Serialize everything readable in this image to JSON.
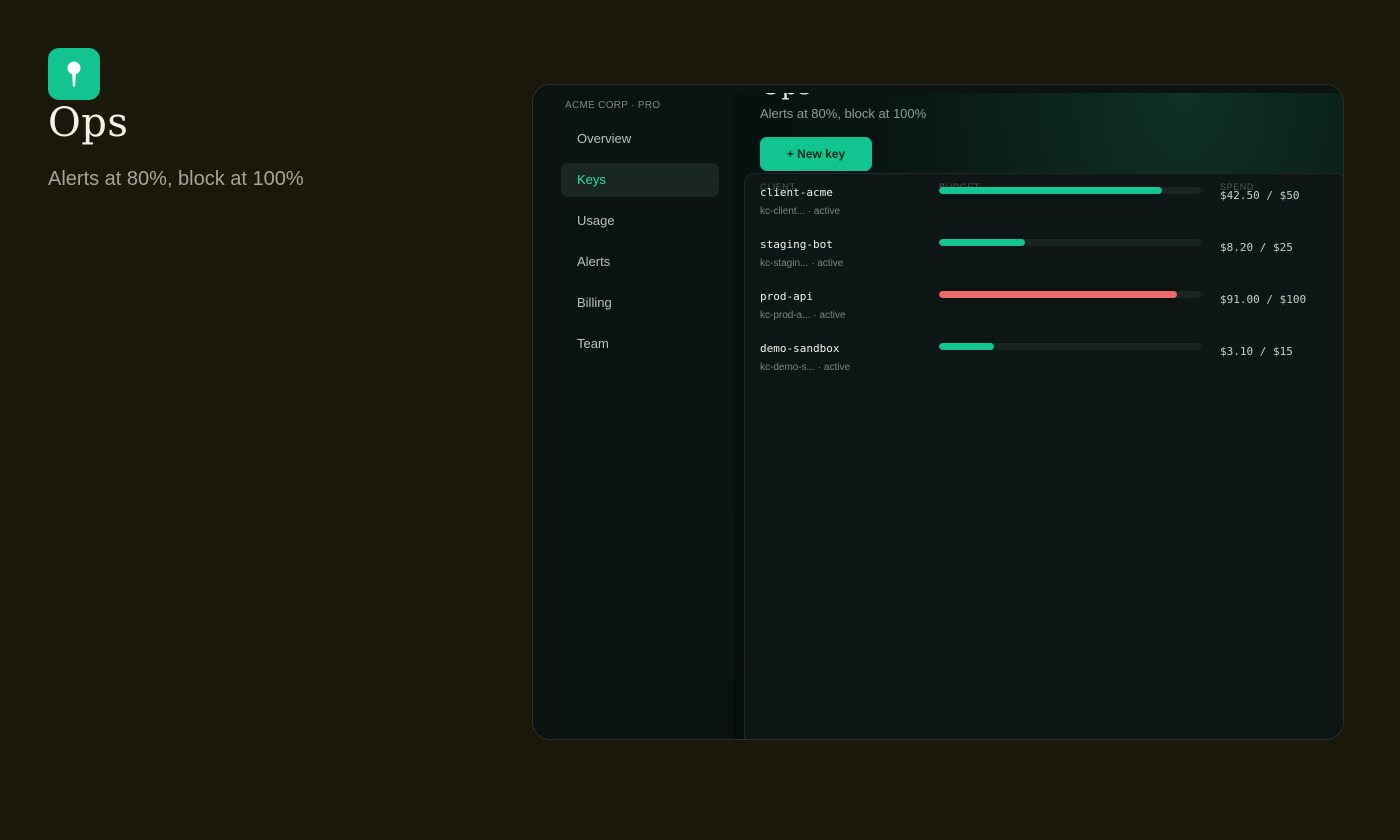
{
  "hero": {
    "logo_icon": "keyhole-icon",
    "title": "Ops",
    "subtitle": "Alerts at 80%, block at 100%"
  },
  "sidebar": {
    "org": "ACME CORP · PRO",
    "items": [
      {
        "label": "Overview",
        "active": false
      },
      {
        "label": "Keys",
        "active": true
      },
      {
        "label": "Usage",
        "active": false
      },
      {
        "label": "Alerts",
        "active": false
      },
      {
        "label": "Billing",
        "active": false
      },
      {
        "label": "Team",
        "active": false
      }
    ]
  },
  "main": {
    "title": "Ops",
    "subtitle": "Alerts at 80%, block at 100%",
    "new_key_label": "+ New key",
    "columns": [
      "Client",
      "Budget",
      "Spend"
    ],
    "rows": [
      {
        "name": "client-acme",
        "meta": "kc-client... · active",
        "usage": 0.85,
        "budget": "$42.50 / $50",
        "pct": "85",
        "status": "ok"
      },
      {
        "name": "staging-bot",
        "meta": "kc-stagin... · active",
        "usage": 0.33,
        "budget": "$8.20 / $25",
        "pct": "33",
        "status": "ok"
      },
      {
        "name": "prod-api",
        "meta": "kc-prod-a... · active",
        "usage": 0.91,
        "budget": "$91.00 / $100",
        "pct": "91",
        "status": "danger"
      },
      {
        "name": "demo-sandbox",
        "meta": "kc-demo-s... · active",
        "usage": 0.21,
        "budget": "$3.10 / $15",
        "pct": "21",
        "status": "ok"
      }
    ]
  },
  "colors": {
    "accent": "#12c48f",
    "danger": "#ef6b6b",
    "background": "#1a170b"
  }
}
